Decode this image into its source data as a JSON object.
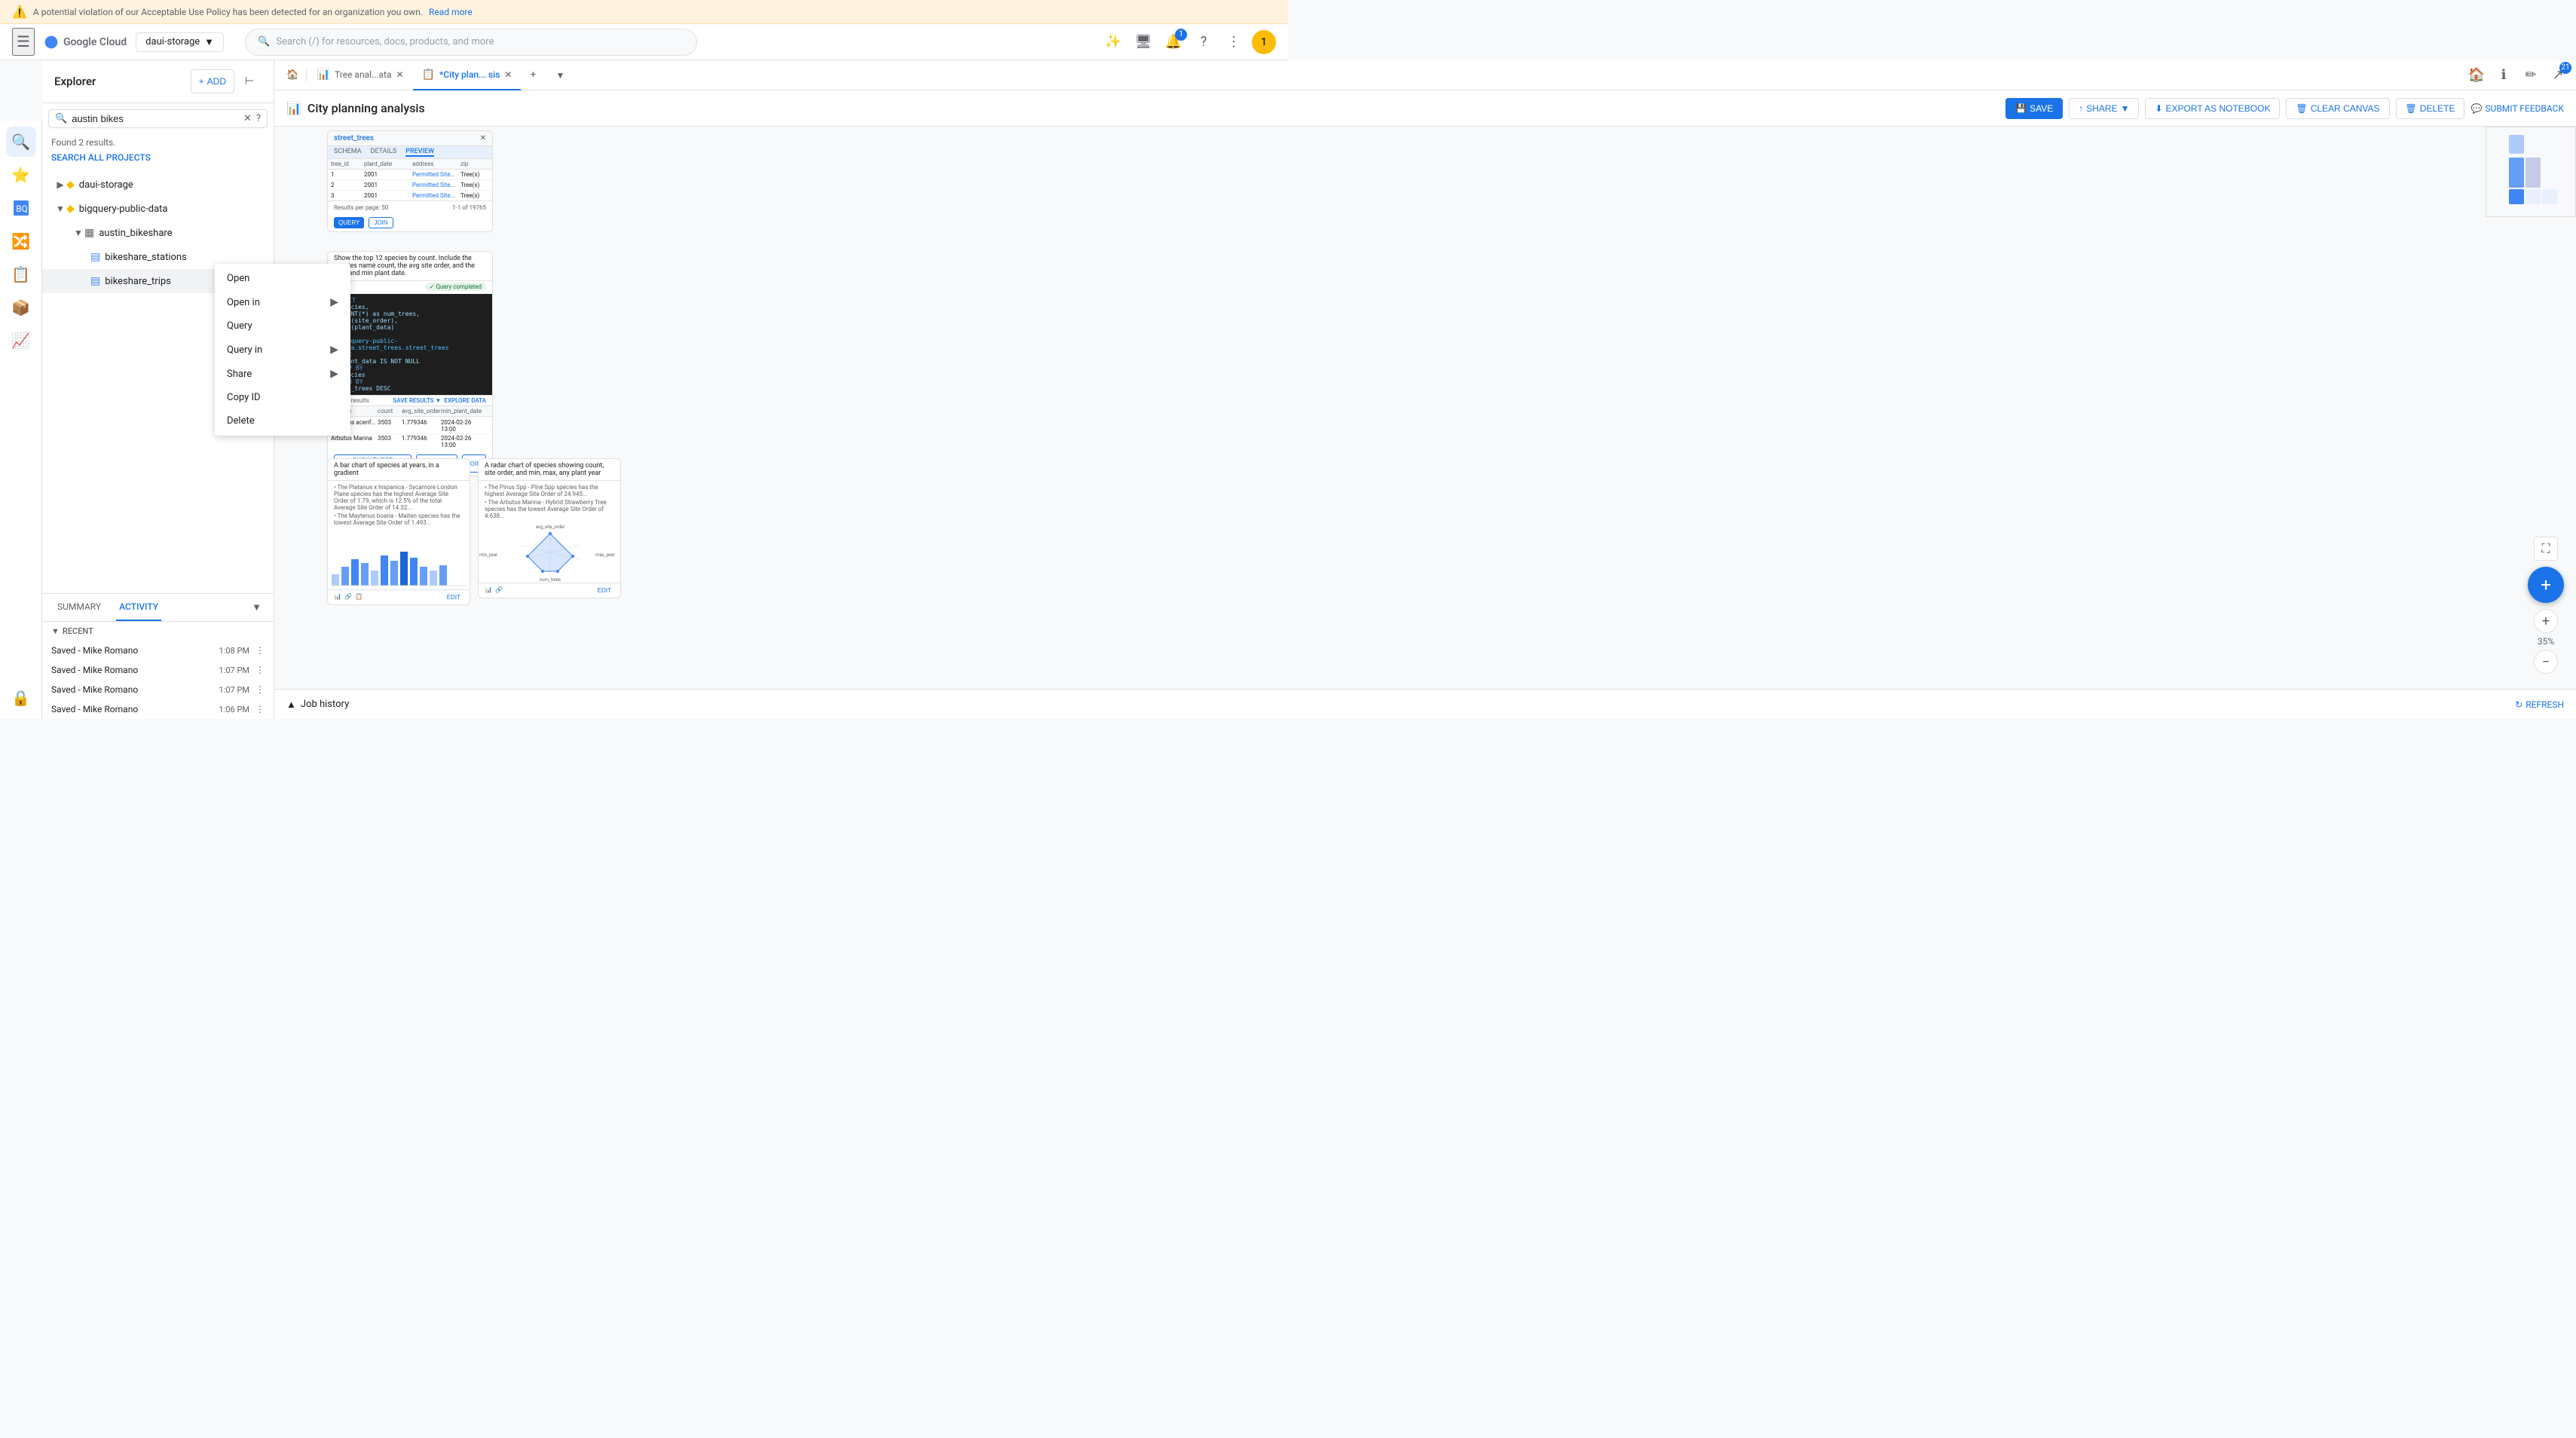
{
  "banner": {
    "message": "A potential violation of our Acceptable Use Policy has been detected for an organization you own.",
    "link_text": "Read more"
  },
  "topnav": {
    "hamburger": "☰",
    "project": "daui-storage",
    "search_placeholder": "Search (/) for resources, docs, products, and more",
    "search_label": "Search"
  },
  "explorer": {
    "title": "Explorer",
    "add_label": "ADD",
    "search_value": "austin bikes",
    "results_text": "Found 2 results.",
    "search_all_label": "SEARCH ALL PROJECTS",
    "tree": [
      {
        "id": "daui-storage",
        "label": "daui-storage",
        "level": 0,
        "type": "project",
        "expanded": false
      },
      {
        "id": "bigquery-public-data",
        "label": "bigquery-public-data",
        "level": 0,
        "type": "project",
        "expanded": true
      },
      {
        "id": "austin_bikeshare",
        "label": "austin_bikeshare",
        "level": 1,
        "type": "dataset",
        "expanded": true
      },
      {
        "id": "bikeshare_stations",
        "label": "bikeshare_stations",
        "level": 2,
        "type": "table"
      },
      {
        "id": "bikeshare_trips",
        "label": "bikeshare_trips",
        "level": 2,
        "type": "table",
        "active": true
      }
    ]
  },
  "context_menu": {
    "items": [
      {
        "id": "open",
        "label": "Open",
        "has_submenu": false
      },
      {
        "id": "open-in",
        "label": "Open in",
        "has_submenu": true
      },
      {
        "id": "query",
        "label": "Query",
        "has_submenu": false
      },
      {
        "id": "query-in",
        "label": "Query in",
        "has_submenu": true
      },
      {
        "id": "share",
        "label": "Share",
        "has_submenu": true
      },
      {
        "id": "copy-id",
        "label": "Copy ID",
        "has_submenu": false
      },
      {
        "id": "delete",
        "label": "Delete",
        "has_submenu": false
      }
    ]
  },
  "tabs": {
    "items": [
      {
        "id": "home",
        "label": "🏠",
        "is_home": true
      },
      {
        "id": "tree-analysis",
        "label": "Tree anal...ata",
        "closeable": true,
        "icon": "📊"
      },
      {
        "id": "city-planning",
        "label": "*City plan... sis",
        "closeable": true,
        "icon": "📋",
        "active": true
      }
    ],
    "add_tab": "+"
  },
  "canvas": {
    "title": "City planning analysis",
    "icon": "📊",
    "actions": {
      "save": "SAVE",
      "share": "SHARE",
      "export_notebook": "EXPORT AS NOTEBOOK",
      "clear_canvas": "CLEAR CANVAS",
      "delete": "DELETE",
      "submit_feedback": "SUBMIT FEEDBACK"
    }
  },
  "activity": {
    "tabs": [
      "SUMMARY",
      "ACTIVITY"
    ],
    "active_tab": "ACTIVITY",
    "recent_label": "Recent",
    "items": [
      {
        "label": "Saved - Mike Romano",
        "time": "1:08 PM"
      },
      {
        "label": "Saved - Mike Romano",
        "time": "1:07 PM"
      },
      {
        "label": "Saved - Mike Romano",
        "time": "1:07 PM"
      },
      {
        "label": "Saved - Mike Romano",
        "time": "1:06 PM"
      }
    ]
  },
  "job_history": {
    "label": "Job history",
    "refresh_label": "REFRESH"
  },
  "zoom": {
    "level": "35%",
    "plus": "+",
    "minus": "−"
  },
  "rail_icons": [
    "🔍",
    "⭐",
    "📊",
    "🔀",
    "📋",
    "📦",
    "📈",
    "🔒"
  ],
  "colors": {
    "blue": "#1a73e8",
    "light_blue": "#e8f0fe",
    "border": "#e0e0e0",
    "text_secondary": "#5f6368",
    "warning_bg": "#fff3e0"
  }
}
